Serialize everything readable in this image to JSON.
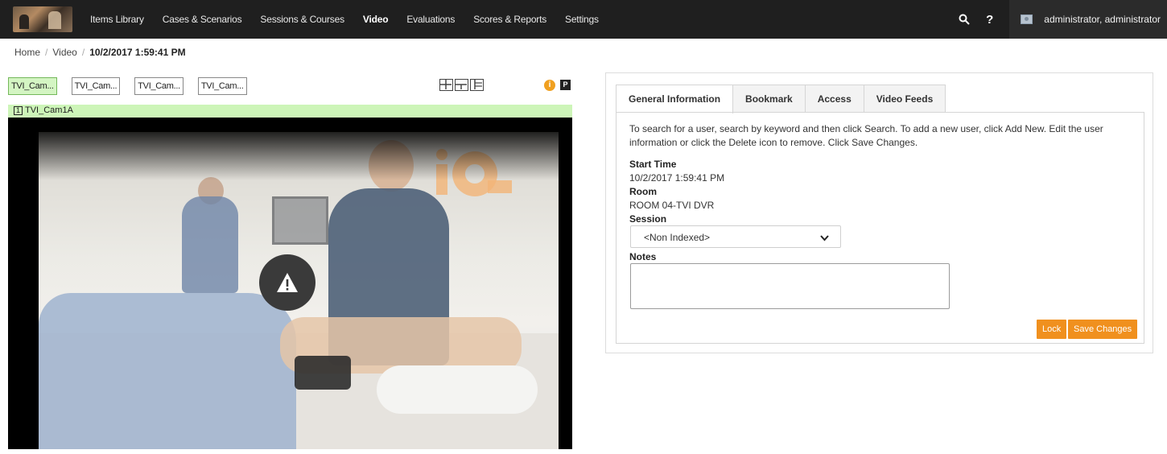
{
  "nav": {
    "items": [
      {
        "label": "Items Library",
        "active": false
      },
      {
        "label": "Cases & Scenarios",
        "active": false
      },
      {
        "label": "Sessions & Courses",
        "active": false
      },
      {
        "label": "Video",
        "active": true
      },
      {
        "label": "Evaluations",
        "active": false
      },
      {
        "label": "Scores & Reports",
        "active": false
      },
      {
        "label": "Settings",
        "active": false
      }
    ],
    "help_label": "?",
    "user": "administrator, administrator"
  },
  "breadcrumb": {
    "home": "Home",
    "section": "Video",
    "current": "10/2/2017 1:59:41 PM"
  },
  "cameras": {
    "tabs": [
      "TVI_Cam...",
      "TVI_Cam...",
      "TVI_Cam...",
      "TVI_Cam..."
    ],
    "active_index": 0,
    "active_label": "TVI_Cam1A",
    "active_number": "1",
    "info_glyph": "i",
    "pin_glyph": "P"
  },
  "details": {
    "tabs": [
      "General Information",
      "Bookmark",
      "Access",
      "Video Feeds"
    ],
    "active_tab": 0,
    "intro": "To search for a user, search by keyword and then click Search. To add a new user, click Add New. Edit the user information or click the Delete icon to remove. Click Save Changes.",
    "start_time_label": "Start Time",
    "start_time_value": "10/2/2017 1:59:41 PM",
    "room_label": "Room",
    "room_value": "ROOM 04-TVI DVR",
    "session_label": "Session",
    "session_value": "<Non Indexed>",
    "notes_label": "Notes",
    "notes_value": "",
    "lock_button": "Lock",
    "save_button": "Save Changes"
  },
  "colors": {
    "nav_bg": "#1f1f1f",
    "accent_orange": "#f0901e",
    "camera_bar_green": "#cdf5b8"
  }
}
